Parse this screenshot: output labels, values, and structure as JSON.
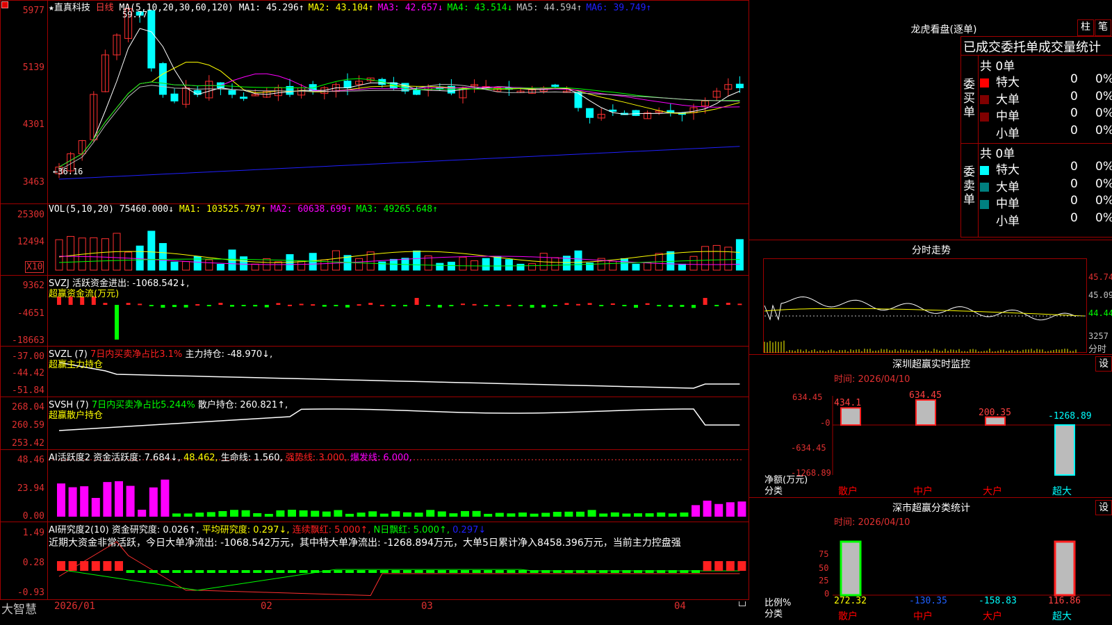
{
  "brand": "大智慧",
  "stock": {
    "name": "直真科技",
    "period": "日线"
  },
  "main_chart": {
    "ma_label": "MA(5,10,20,30,60,120)",
    "ma": [
      {
        "label": "MA1: 45.296↑",
        "color": "#ffffff"
      },
      {
        "label": "MA2: 43.104↑",
        "color": "#ffff00"
      },
      {
        "label": "MA3: 42.657↓",
        "color": "#ff00ff"
      },
      {
        "label": "MA4: 43.514↓",
        "color": "#00ff00"
      },
      {
        "label": "MA5: 44.594↑",
        "color": "#c0c0c0"
      },
      {
        "label": "MA6: 39.749↑",
        "color": "#2020ff"
      }
    ],
    "y_ticks": [
      "5977",
      "5139",
      "4301",
      "3463"
    ],
    "high_label": "59.77",
    "low_label": "←36.16"
  },
  "vol_chart": {
    "title": "VOL(5,10,20)",
    "value": "75460.000↓",
    "ma": [
      {
        "label": "MA1: 103525.797↑",
        "color": "#ffff00"
      },
      {
        "label": "MA2: 60638.699↑",
        "color": "#ff00ff"
      },
      {
        "label": "MA3: 49265.648↑",
        "color": "#00ff00"
      }
    ],
    "y_ticks": [
      "25300",
      "12494"
    ],
    "unit": "X10"
  },
  "svzj": {
    "title": "SVZJ  活跃资金进出: -1068.542↓,",
    "subtitle": "超赢资金流(万元)",
    "y_ticks": [
      "9362",
      "-4651",
      "-18663"
    ]
  },
  "svzl": {
    "title_a": "SVZL (7)",
    "title_b": "7日内买卖净占比3.1%",
    "title_c": "主力持仓: -48.970↓,",
    "subtitle": "超赢主力持仓",
    "y_ticks": [
      "-37.00",
      "-44.42",
      "-51.84"
    ]
  },
  "svsh": {
    "title_a": "SVSH (7)",
    "title_b": "7日内买卖净占比5.244%",
    "title_c": "散户持仓: 260.821↑,",
    "subtitle": "超赢散户持仓",
    "y_ticks": [
      "268.04",
      "260.59",
      "253.42"
    ]
  },
  "ai_active": {
    "title": "AI活跃度2  资金活跃度: 7.684↓,",
    "v2": "48.462,",
    "v3": "生命线: 1.560,",
    "v4": "强势线: 3.000,",
    "v5": "爆发线: 6.000,",
    "y_ticks": [
      "48.46",
      "23.94",
      "0.00"
    ]
  },
  "ai_research": {
    "title": "AI研究度2(10)  资金研究度: 0.026↑,",
    "v2": "平均研究度: 0.297↓,",
    "v3": "连续飘红: 5.000↑,",
    "v4": "N日飘红: 5.000↑,",
    "v5": "0.297↓",
    "comment": "近期大资金非常活跃，今日大单净流出: -1068.542万元，其中特大单净流出: -1268.894万元，大单5日累计净入8458.396万元，当前主力控盘强",
    "y_ticks": [
      "1.49",
      "0.28",
      "-0.93"
    ]
  },
  "x_axis": [
    "2026/01",
    "02",
    "03",
    "04"
  ],
  "lhb": {
    "title": "龙虎看盘(逐单)",
    "btn_bar": "柱",
    "btn_pen": "笔",
    "header": "已成交委托单成交量统计",
    "buy_label": "委买单",
    "sell_label": "委卖单",
    "buy_total": "共 0单",
    "sell_total": "共 0单",
    "buy_rows": [
      {
        "name": "特大",
        "count": "0",
        "pct": "0%",
        "color": "#ff0000"
      },
      {
        "name": "大单",
        "count": "0",
        "pct": "0%",
        "color": "#800000"
      },
      {
        "name": "中单",
        "count": "0",
        "pct": "0%",
        "color": "#800000"
      },
      {
        "name": "小单",
        "count": "0",
        "pct": "0%",
        "color": "#000000"
      }
    ],
    "sell_rows": [
      {
        "name": "特大",
        "count": "0",
        "pct": "0%",
        "color": "#00ffff"
      },
      {
        "name": "大单",
        "count": "0",
        "pct": "0%",
        "color": "#008080"
      },
      {
        "name": "中单",
        "count": "0",
        "pct": "0%",
        "color": "#008080"
      },
      {
        "name": "小单",
        "count": "0",
        "pct": "0%",
        "color": "#000000"
      }
    ]
  },
  "intraday": {
    "title": "分时走势",
    "y_ticks": [
      "45.74",
      "45.09",
      "44.44"
    ],
    "vol_label": "3257",
    "unit": "分时"
  },
  "monitor": {
    "title": "深圳超赢实时监控",
    "btn": "设",
    "time": "时间: 2026/04/10",
    "y_ticks": [
      "634.45",
      "-0",
      "-634.45",
      "-1268.89"
    ],
    "ylabel": "净额(万元)",
    "xlabel": "分类",
    "bars": [
      {
        "cat": "散户",
        "value": "434.1"
      },
      {
        "cat": "中户",
        "value": "634.45"
      },
      {
        "cat": "大户",
        "value": "200.35"
      },
      {
        "cat": "超大",
        "value": "-1268.89"
      }
    ]
  },
  "classify": {
    "title": "深市超赢分类统计",
    "btn": "设",
    "time": "时间: 2026/04/10",
    "y_ticks": [
      "75",
      "50",
      "25",
      "0"
    ],
    "ylabel": "比例%",
    "xlabel": "分类",
    "bars": [
      {
        "cat": "散户",
        "value": "272.32"
      },
      {
        "cat": "中户",
        "value": "-130.35"
      },
      {
        "cat": "大户",
        "value": "-158.83"
      },
      {
        "cat": "超大",
        "value": "116.86"
      }
    ]
  },
  "chart_data": {
    "type": "table",
    "monitor_net": [
      {
        "cat": "散户",
        "value": 434.1
      },
      {
        "cat": "中户",
        "value": 634.45
      },
      {
        "cat": "大户",
        "value": 200.35
      },
      {
        "cat": "超大",
        "value": -1268.89
      }
    ],
    "classify_ratio": [
      {
        "cat": "散户",
        "value": 272.32
      },
      {
        "cat": "中户",
        "value": -130.35
      },
      {
        "cat": "大户",
        "value": -158.83
      },
      {
        "cat": "超大",
        "value": 116.86
      }
    ]
  }
}
